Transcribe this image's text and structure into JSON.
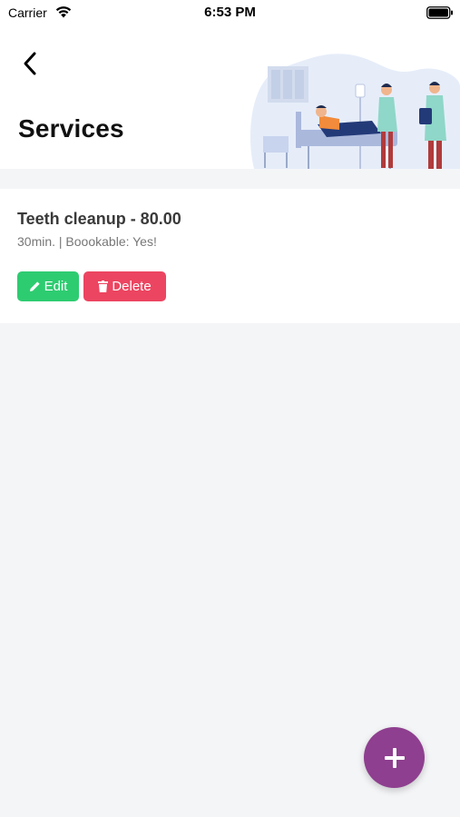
{
  "status_bar": {
    "carrier": "Carrier",
    "time": "6:53 PM"
  },
  "header": {
    "title": "Services",
    "back_icon": "chevron-left-icon",
    "illustration": "hospital-bed-illustration"
  },
  "services": [
    {
      "title": "Teeth cleanup - 80.00",
      "meta": "30min. | Boookable: Yes!",
      "edit_label": "Edit",
      "delete_label": "Delete"
    }
  ],
  "fab": {
    "icon": "plus-icon"
  },
  "colors": {
    "edit": "#2ecc71",
    "delete": "#ec4561",
    "fab": "#8e3f8f",
    "background": "#f4f5f7"
  }
}
